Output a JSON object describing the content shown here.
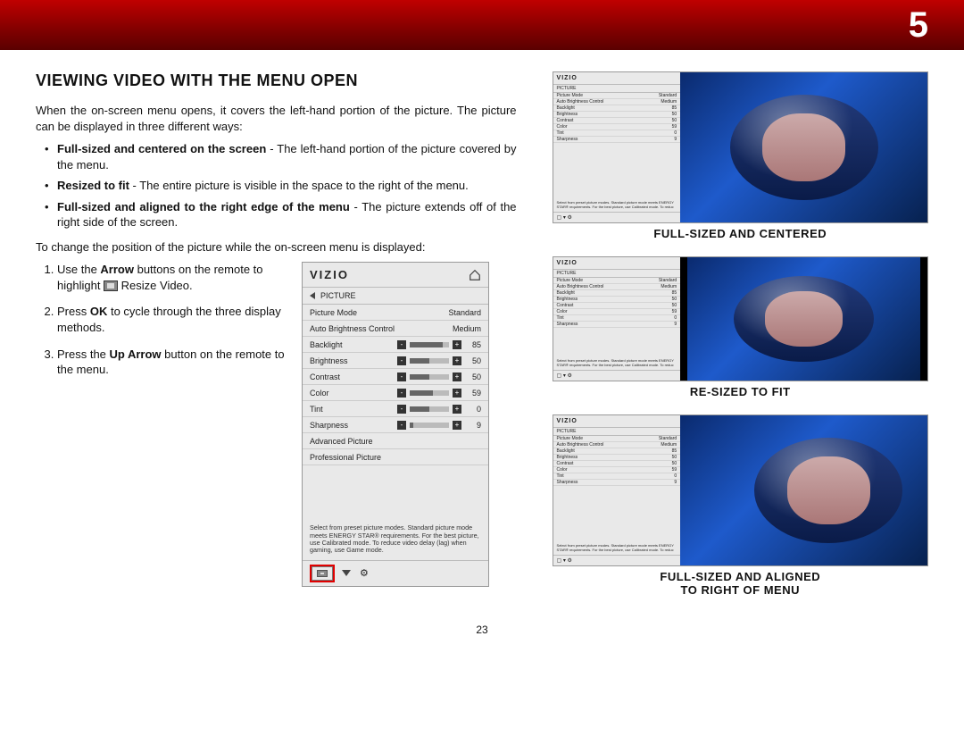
{
  "chapter_number": "5",
  "page_number": "23",
  "heading": "VIEWING VIDEO WITH THE MENU OPEN",
  "intro": "When the on-screen menu opens, it covers the left-hand portion of the picture. The picture can be displayed in three different ways:",
  "bullets": [
    {
      "bold": "Full-sized and centered on the screen",
      "rest": " - The left-hand portion of the picture covered by the menu."
    },
    {
      "bold": "Resized to fit",
      "rest": " - The entire picture is visible in the space to the right of the menu."
    },
    {
      "bold": "Full-sized and aligned to the right edge of the menu",
      "rest": " - The picture extends off of the right side of the screen."
    }
  ],
  "change_intro": "To change the position of the picture while the on-screen menu is displayed:",
  "steps": [
    {
      "pre": "Use the ",
      "bold": "Arrow",
      "post": " buttons on the remote to highlight ",
      "icon": true,
      "tail": " Resize Video."
    },
    {
      "pre": "Press ",
      "bold": "OK",
      "post": " to cycle through the three display methods.",
      "icon": false,
      "tail": ""
    },
    {
      "pre": "Press the ",
      "bold": "Up Arrow",
      "post": " button on the remote to the menu.",
      "icon": false,
      "tail": ""
    }
  ],
  "osd": {
    "brand": "VIZIO",
    "crumb": "PICTURE",
    "rows": [
      {
        "label": "Picture Mode",
        "value": "Standard",
        "slider": false
      },
      {
        "label": "Auto Brightness Control",
        "value": "Medium",
        "slider": false
      },
      {
        "label": "Backlight",
        "value": "85",
        "slider": true,
        "pct": 85
      },
      {
        "label": "Brightness",
        "value": "50",
        "slider": true,
        "pct": 50
      },
      {
        "label": "Contrast",
        "value": "50",
        "slider": true,
        "pct": 50
      },
      {
        "label": "Color",
        "value": "59",
        "slider": true,
        "pct": 59
      },
      {
        "label": "Tint",
        "value": "0",
        "slider": true,
        "pct": 50
      },
      {
        "label": "Sharpness",
        "value": "9",
        "slider": true,
        "pct": 9
      },
      {
        "label": "Advanced Picture",
        "value": "",
        "slider": false
      },
      {
        "label": "Professional Picture",
        "value": "",
        "slider": false
      }
    ],
    "note": "Select from preset picture modes. Standard picture mode meets ENERGY STAR® requirements. For the best picture, use Calibrated mode. To reduce video delay (lag) when gaming, use Game mode."
  },
  "captions": {
    "a": "FULL-SIZED AND CENTERED",
    "b": "RE-SIZED TO FIT",
    "c1": "FULL-SIZED AND ALIGNED",
    "c2": "TO RIGHT OF MENU"
  }
}
